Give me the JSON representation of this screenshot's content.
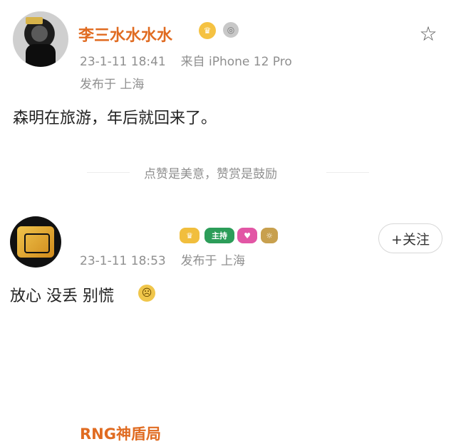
{
  "posts": [
    {
      "author": "李三水水水水",
      "timestamp": "23-1-11 18:41",
      "source": "来自 iPhone 12 Pro",
      "location": "发布于 上海",
      "content": "森明在旅游，年后就回来了。",
      "reward_text": "点赞是美意，赞赏是鼓励",
      "crown_icon": "crown-icon",
      "medal_icon": "medal-icon",
      "star_icon": "star-icon"
    },
    {
      "author": "RNG神盾局",
      "badge_label": "主持",
      "timestamp": "23-1-11 18:53",
      "location": "发布于 上海",
      "content": "放心 没丢 别慌",
      "follow_label": "+关注",
      "verified_icon": "verified-icon",
      "emoji_icon": "worried-face-icon"
    }
  ]
}
